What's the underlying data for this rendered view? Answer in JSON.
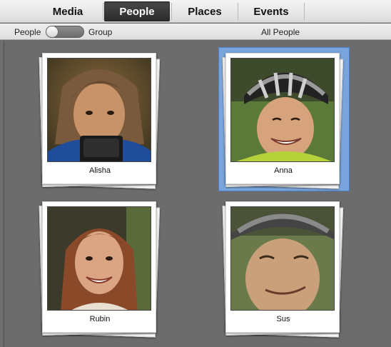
{
  "tabs": [
    {
      "label": "Media",
      "active": false
    },
    {
      "label": "People",
      "active": true
    },
    {
      "label": "Places",
      "active": false
    },
    {
      "label": "Events",
      "active": false
    }
  ],
  "subbar": {
    "left_label": "People",
    "right_label": "Group",
    "title": "All People"
  },
  "people": [
    {
      "name": "Alisha",
      "selected": false
    },
    {
      "name": "Anna",
      "selected": true
    },
    {
      "name": "Rubin",
      "selected": false
    },
    {
      "name": "Sus",
      "selected": false
    }
  ],
  "colors": {
    "selection": "#7aa5dc",
    "background": "#6e6e6e"
  }
}
